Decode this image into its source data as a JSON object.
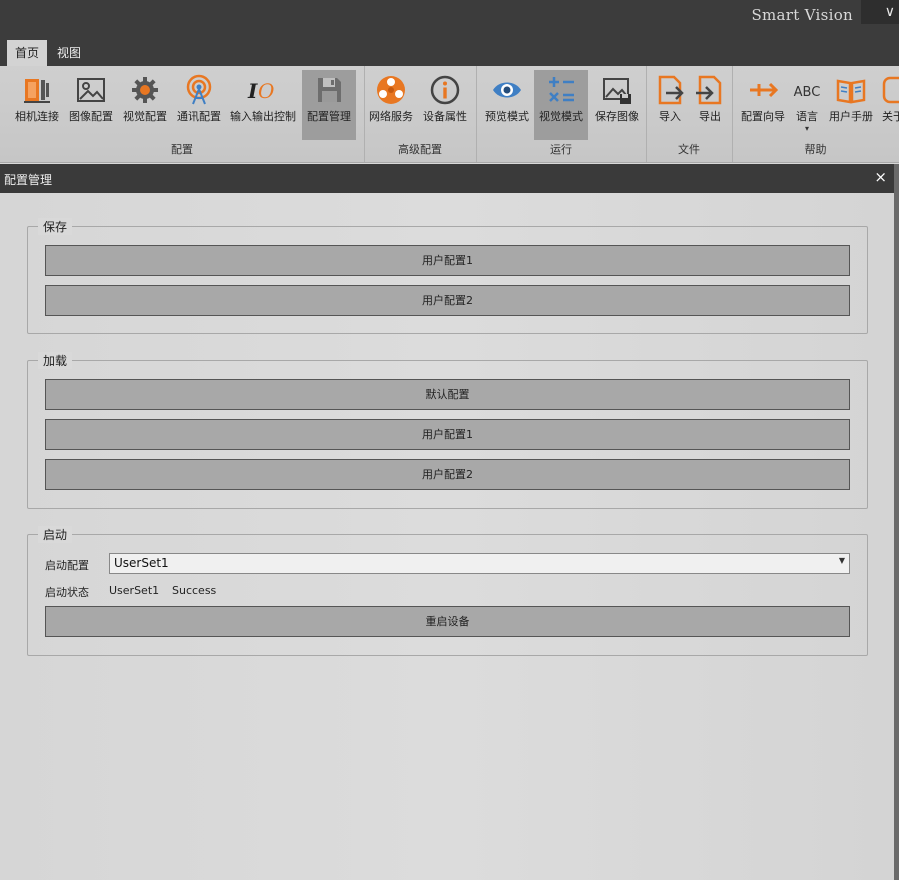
{
  "app": {
    "title": "Smart Vision",
    "chevron": "∨"
  },
  "tabs": [
    {
      "label": "首页",
      "active": true
    },
    {
      "label": "视图",
      "active": false
    }
  ],
  "ribbon": {
    "groups": [
      {
        "label": "配置",
        "buttons": [
          {
            "label": "相机连接",
            "icon": "camera-connect-icon"
          },
          {
            "label": "图像配置",
            "icon": "image-icon"
          },
          {
            "label": "视觉配置",
            "icon": "gear-icon"
          },
          {
            "label": "通讯配置",
            "icon": "antenna-icon"
          },
          {
            "label": "输入输出控制",
            "icon": "io-icon"
          },
          {
            "label": "配置管理",
            "icon": "floppy-icon",
            "active": true
          }
        ]
      },
      {
        "label": "高级配置",
        "buttons": [
          {
            "label": "网络服务",
            "icon": "network-icon"
          },
          {
            "label": "设备属性",
            "icon": "info-icon"
          }
        ]
      },
      {
        "label": "运行",
        "buttons": [
          {
            "label": "预览模式",
            "icon": "eye-icon"
          },
          {
            "label": "视觉模式",
            "icon": "calculator-icon",
            "active": true
          },
          {
            "label": "保存图像",
            "icon": "save-image-icon"
          }
        ]
      },
      {
        "label": "文件",
        "buttons": [
          {
            "label": "导入",
            "icon": "import-icon"
          },
          {
            "label": "导出",
            "icon": "export-icon"
          }
        ]
      },
      {
        "label": "帮助",
        "buttons": [
          {
            "label": "配置向导",
            "icon": "wizard-icon"
          },
          {
            "label": "语言",
            "icon": "abc-icon",
            "icon_text": "ABC"
          },
          {
            "label": "用户手册",
            "icon": "book-icon"
          },
          {
            "label": "关于",
            "icon": "about-icon"
          }
        ]
      }
    ]
  },
  "panel": {
    "title": "配置管理",
    "close": "×",
    "save": {
      "title": "保存",
      "buttons": [
        "用户配置1",
        "用户配置2"
      ]
    },
    "load": {
      "title": "加载",
      "buttons": [
        "默认配置",
        "用户配置1",
        "用户配置2"
      ]
    },
    "startup": {
      "title": "启动",
      "config_label": "启动配置",
      "config_value": "UserSet1",
      "status_label": "启动状态",
      "status_set": "UserSet1",
      "status_result": "Success",
      "restart_label": "重启设备"
    }
  },
  "colors": {
    "orange": "#e87722",
    "blue": "#3f7fc4",
    "dark_bar": "#3c3c3c"
  }
}
